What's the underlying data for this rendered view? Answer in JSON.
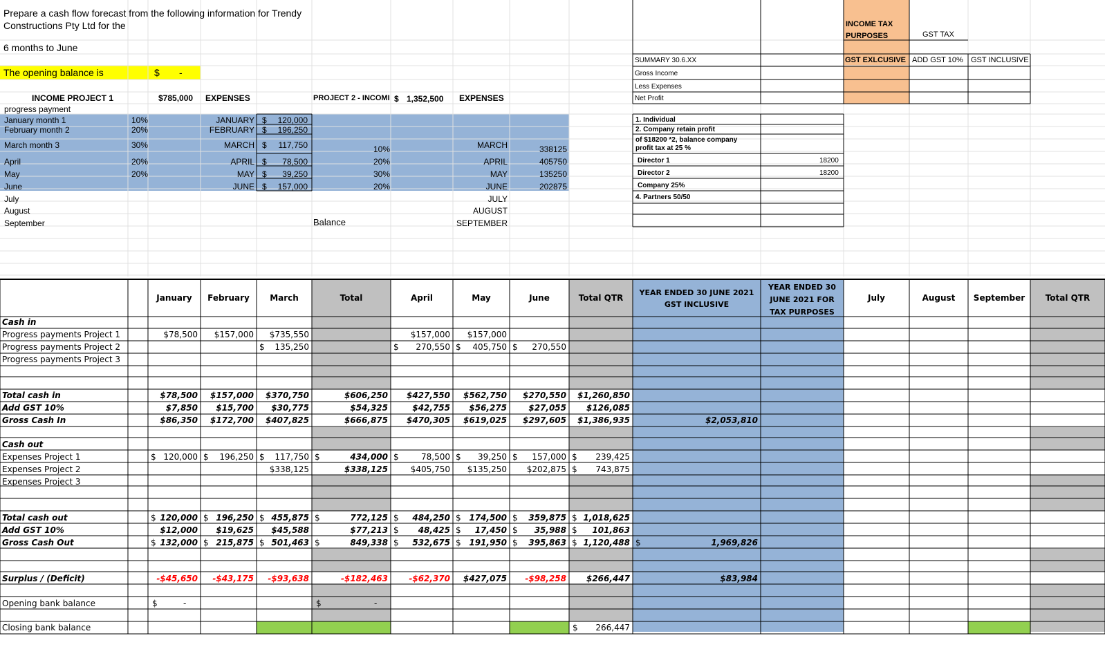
{
  "colors": {
    "yellow": "#ffff00",
    "blue_fill": "#95b3d7",
    "grey_fill": "#c0c0c0",
    "green_fill": "#92d050",
    "orange_fill": "#f8c090",
    "negative_red": "#ff0000"
  },
  "header": {
    "prompt_line1": "Prepare a cash flow forecast from the following information for Trendy",
    "prompt_line2": "Constructions Pty Ltd for the",
    "prompt_line3": "6 months to June",
    "opening_label": "The opening balance is",
    "opening_currency": "$",
    "opening_dash": "-"
  },
  "income_block": {
    "title": "INCOME PROJECT 1",
    "total": "$785,000",
    "expenses_title": "EXPENSES",
    "project2_title": "PROJECT 2 - INCOMI",
    "project2_currency": "$",
    "project2_total": "1,352,500",
    "expenses2_title": "EXPENSES",
    "progress_label": "progress payment",
    "balance_label": "Balance",
    "rows": [
      {
        "label": "January month 1",
        "pct": "10%",
        "month": "JANUARY",
        "cur": "$",
        "amount": "120,000",
        "p2_pct": "",
        "p2_month": "",
        "p2_amount": ""
      },
      {
        "label": "February month 2",
        "pct": "20%",
        "month": "FEBRUARY",
        "cur": "$",
        "amount": "196,250",
        "p2_pct": "",
        "p2_month": "",
        "p2_amount": ""
      },
      {
        "label": "March month 3",
        "pct": "30%",
        "month": "MARCH",
        "cur": "$",
        "amount": "117,750",
        "p2_pct": "10%",
        "p2_month": "MARCH",
        "p2_amount": "338125"
      },
      {
        "label": "April",
        "pct": "20%",
        "month": "APRIL",
        "cur": "$",
        "amount": "78,500",
        "p2_pct": "20%",
        "p2_month": "APRIL",
        "p2_amount": "405750"
      },
      {
        "label": "May",
        "pct": "20%",
        "month": "MAY",
        "cur": "$",
        "amount": "39,250",
        "p2_pct": "30%",
        "p2_month": "MAY",
        "p2_amount": "135250"
      },
      {
        "label": "June",
        "pct": "",
        "month": "JUNE",
        "cur": "$",
        "amount": "157,000",
        "p2_pct": "20%",
        "p2_month": "JUNE",
        "p2_amount": "202875"
      },
      {
        "label": "July",
        "pct": "",
        "month": "",
        "cur": "",
        "amount": "",
        "p2_pct": "",
        "p2_month": "JULY",
        "p2_amount": ""
      },
      {
        "label": "August",
        "pct": "",
        "month": "",
        "cur": "",
        "amount": "",
        "p2_pct": "",
        "p2_month": "AUGUST",
        "p2_amount": ""
      },
      {
        "label": "September",
        "pct": "",
        "month": "",
        "cur": "",
        "amount": "",
        "p2_pct": "",
        "p2_month": "SEPTEMBER",
        "p2_amount": ""
      }
    ]
  },
  "summary": {
    "title": "SUMMARY 30.6.XX",
    "lines": [
      "Gross Income",
      "Less Expenses",
      "Net Profit"
    ]
  },
  "entity_box": {
    "lines": [
      "1. Individual",
      "2. Company retain profit",
      "of $18200 *2, balance company",
      "profit tax at 25 %",
      "Director 1",
      "Director 2",
      "Company 25%",
      "4. Partners 50/50"
    ],
    "director1_value": "18200",
    "director2_value": "18200"
  },
  "tax_header": {
    "income_tax": "INCOME TAX PURPOSES",
    "gst_tax": "GST TAX",
    "gst_exclusive": "GST EXLCUSIVE",
    "add_gst": "ADD GST 10%",
    "gst_inclusive": "GST INCLUSIVE"
  },
  "cashflow": {
    "columns": {
      "january": "January",
      "february": "February",
      "march": "March",
      "total": "Total",
      "april": "April",
      "may": "May",
      "june": "June",
      "total_qtr": "Total QTR",
      "year_gst": "YEAR ENDED 30 JUNE 2021 GST INCLUSIVE",
      "year_tax": "YEAR ENDED 30 JUNE 2021 FOR TAX PURPOSES",
      "july": "July",
      "august": "August",
      "september": "September",
      "total_qtr2": "Total QTR"
    },
    "cash_in_label": "Cash in",
    "income_rows": [
      {
        "label": "Progress payments Project 1",
        "jan": "$78,500",
        "feb": "$157,000",
        "mar": "$735,550",
        "apr": "$157,000",
        "may": "$157,000"
      },
      {
        "label": "Progress payments Project 2",
        "mar_cur": "$",
        "mar": "135,250",
        "apr_cur": "$",
        "apr": "270,550",
        "may_cur": "$",
        "may": "405,750",
        "jun_cur": "$",
        "jun": "270,550"
      },
      {
        "label": "Progress payments Project 3"
      }
    ],
    "total_cash_in": {
      "label": "Total cash in",
      "jan": "$78,500",
      "feb": "$157,000",
      "mar": "$370,750",
      "total": "$606,250",
      "apr": "$427,550",
      "may": "$562,750",
      "jun": "$270,550",
      "qtr": "$1,260,850"
    },
    "add_gst_in": {
      "label": "Add GST 10%",
      "jan": "$7,850",
      "feb": "$15,700",
      "mar": "$30,775",
      "total": "$54,325",
      "apr": "$42,755",
      "may": "$56,275",
      "jun": "$27,055",
      "qtr": "$126,085"
    },
    "gross_cash_in": {
      "label": "Gross Cash In",
      "jan": "$86,350",
      "feb": "$172,700",
      "mar": "$407,825",
      "total": "$666,875",
      "apr": "$470,305",
      "may": "$619,025",
      "jun": "$297,605",
      "qtr": "$1,386,935",
      "year": "$2,053,810"
    },
    "cash_out_label": "Cash out",
    "expense_rows": [
      {
        "label": "Expenses Project 1",
        "jan": "120,000",
        "feb": "196,250",
        "mar": "117,750",
        "total": "434,000",
        "apr": "78,500",
        "may": "39,250",
        "jun": "157,000",
        "qtr": "239,425"
      },
      {
        "label": "Expenses Project 2",
        "mar": "$338,125",
        "total": "$338,125",
        "apr": "$405,750",
        "may": "$135,250",
        "jun": "$202,875",
        "qtr": "743,875"
      },
      {
        "label": "Expenses Project 3"
      }
    ],
    "total_cash_out": {
      "label": "Total cash out",
      "jan": "120,000",
      "feb": "196,250",
      "mar": "455,875",
      "total": "772,125",
      "apr": "484,250",
      "may": "174,500",
      "jun": "359,875",
      "qtr": "1,018,625"
    },
    "add_gst_out": {
      "label": "Add GST 10%",
      "jan": "$12,000",
      "feb": "$19,625",
      "mar": "$45,588",
      "total": "$77,213",
      "apr": "48,425",
      "may": "17,450",
      "jun": "35,988",
      "qtr": "101,863"
    },
    "gross_cash_out": {
      "label": "Gross Cash Out",
      "jan": "132,000",
      "feb": "215,875",
      "mar": "501,463",
      "total": "849,338",
      "apr": "532,675",
      "may": "191,950",
      "jun": "395,863",
      "qtr": "1,120,488",
      "year": "1,969,826"
    },
    "surplus": {
      "label": "Surplus / (Deficit)",
      "jan": "-$45,650",
      "feb": "-$43,175",
      "mar": "-$93,638",
      "total": "-$182,463",
      "apr": "-$62,370",
      "may": "$427,075",
      "jun": "-$98,258",
      "qtr": "$266,447",
      "year": "$83,984"
    },
    "opening": {
      "label": "Opening bank balance",
      "cur": "$",
      "dash": "-"
    },
    "closing": {
      "label": "Closing bank balance",
      "cur": "$",
      "qtr": "266,447"
    },
    "currency": "$"
  }
}
